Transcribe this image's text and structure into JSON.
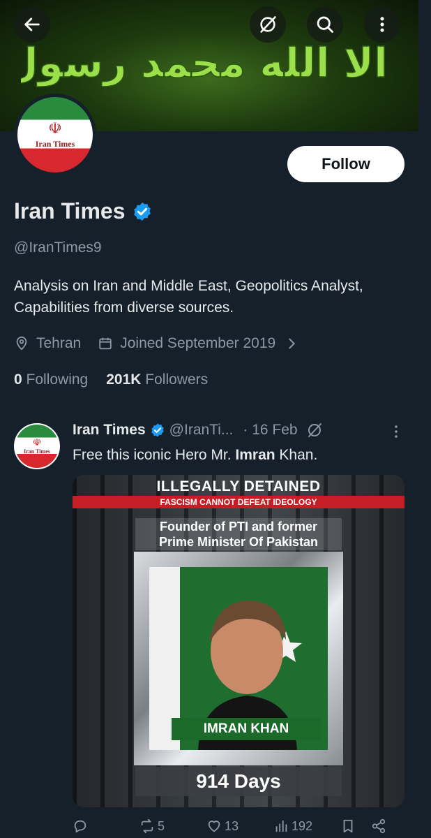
{
  "banner": {
    "calligraphy": "لا اله الا الله محمد رسول الله"
  },
  "toolbar": {
    "back": "back",
    "grok": "grok",
    "search": "search",
    "more": "more"
  },
  "profile": {
    "avatar_label": "Iran Times",
    "avatar_emblem": "☫",
    "follow_label": "Follow",
    "name": "Iran Times",
    "handle": "@IranTimes9",
    "bio": "Analysis on Iran and Middle East, Geopolitics Analyst, Capabilities from diverse sources.",
    "location": "Tehran",
    "joined": "Joined September 2019",
    "following_count": "0",
    "following_label": "Following",
    "followers_count": "201K",
    "followers_label": "Followers"
  },
  "tweet": {
    "author_name": "Iran Times",
    "author_handle": "@IranTi...",
    "date": "· 16 Feb",
    "text_before": "Free this iconic Hero Mr. ",
    "text_bold": "Imran",
    "text_after": " Khan.",
    "media": {
      "title": "ILLEGALLY DETAINED",
      "subtitle": "FASCISM CANNOT DEFEAT IDEOLOGY",
      "caption_line1": "Founder of PTI and former",
      "caption_line2": "Prime Minister Of Pakistan",
      "nameplate": "IMRAN KHAN",
      "days": "914 Days"
    },
    "actions": {
      "replies": "",
      "reposts": "5",
      "likes": "13",
      "views": "192"
    }
  },
  "colors": {
    "background": "#15202b",
    "accent": "#1d9bf0",
    "secondary_text": "#8b98a5"
  }
}
